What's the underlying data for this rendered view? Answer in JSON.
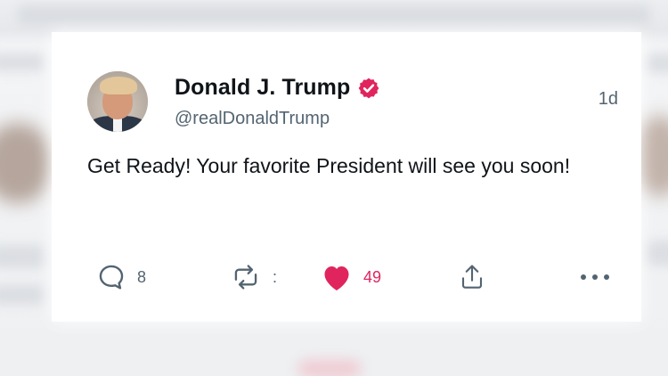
{
  "tweet": {
    "display_name": "Donald J. Trump",
    "handle": "@realDonaldTrump",
    "timestamp": "1d",
    "text": "Get Ready! Your favorite President will see you soon!",
    "verified": true
  },
  "actions": {
    "reply_count": "8",
    "retweet_count": ":",
    "like_count": "49",
    "reply_icon": "comment-bubble-icon",
    "retweet_icon": "retweet-icon",
    "like_icon": "heart-icon",
    "share_icon": "share-icon",
    "more_icon": "more-horizontal-icon"
  },
  "colors": {
    "text_primary": "#0f1419",
    "text_secondary": "#536471",
    "like_active": "#e0245e",
    "verified_badge": "#e0245e"
  }
}
